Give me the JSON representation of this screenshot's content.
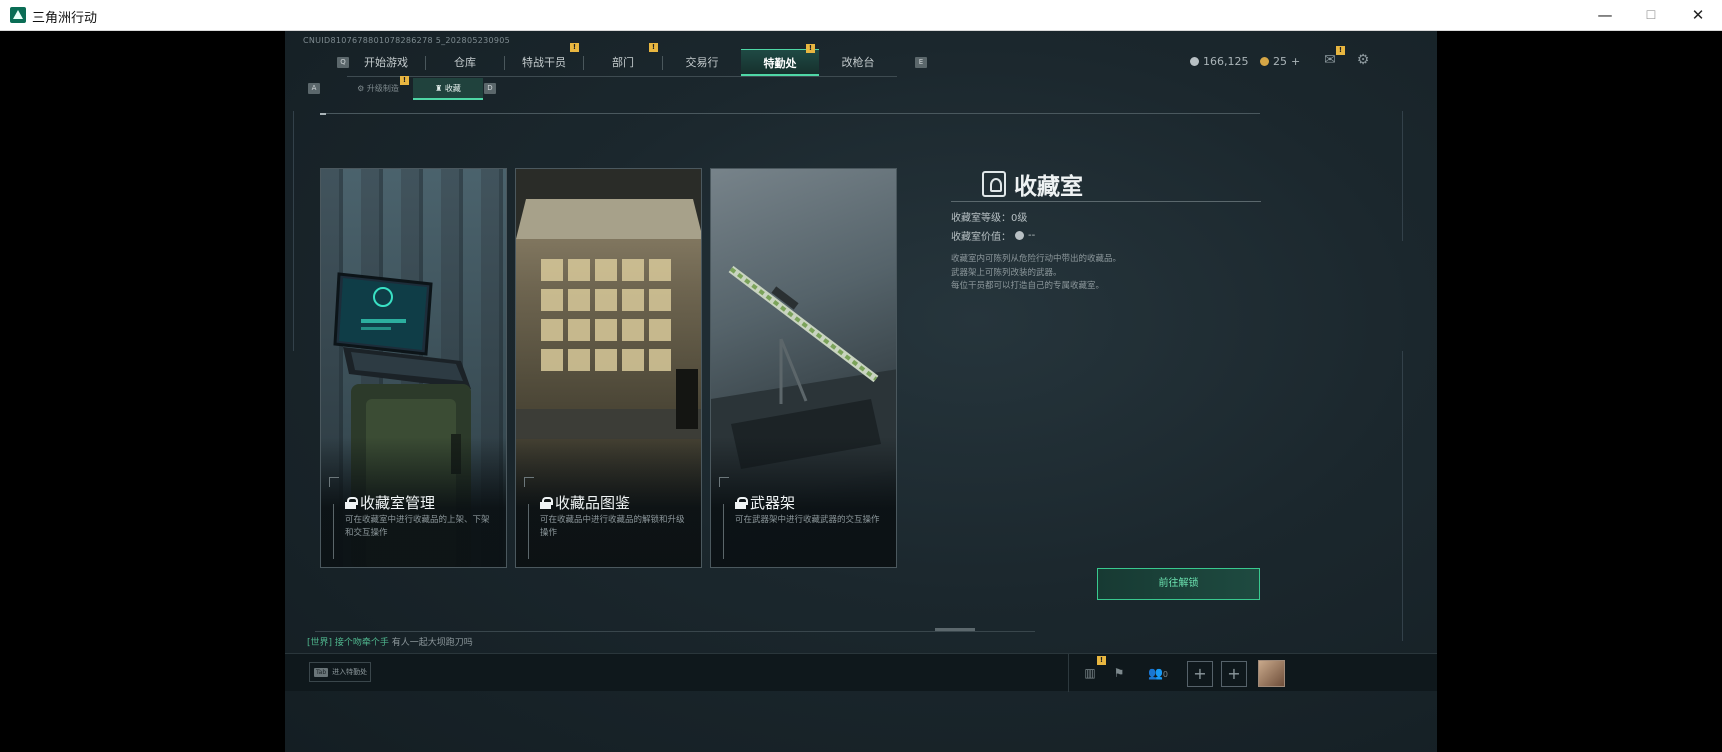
{
  "window": {
    "title": "三角洲行动",
    "minimize": "—",
    "maximize": "☐",
    "close": "✕"
  },
  "uid": "CNUID8107678801078286278 5_202805230905",
  "keyhints": {
    "nav_left": "Q",
    "nav_right": "E",
    "sub_left": "A",
    "sub_right": "D"
  },
  "nav": {
    "items": [
      {
        "label": "开始游戏",
        "badge": ""
      },
      {
        "label": "仓库",
        "badge": ""
      },
      {
        "label": "特战干员",
        "badge": "!"
      },
      {
        "label": "部门",
        "badge": "!"
      },
      {
        "label": "交易行",
        "badge": ""
      },
      {
        "label": "特勤处",
        "badge": "!",
        "active": true
      },
      {
        "label": "改枪台",
        "badge": ""
      }
    ]
  },
  "currency": {
    "silver": "166,125",
    "gold": "25",
    "gold_plus": "+"
  },
  "top_icons": {
    "mail": "mail-icon",
    "settings": "gear-icon",
    "mail_badge": "!"
  },
  "subnav": {
    "items": [
      {
        "label": "升级制造",
        "icon": "wrench-icon",
        "badge": "!"
      },
      {
        "label": "收藏",
        "icon": "trophy-icon",
        "active": true
      }
    ]
  },
  "cards": [
    {
      "title": "收藏室管理",
      "desc": "可在收藏室中进行收藏品的上架、下架和交互操作"
    },
    {
      "title": "收藏品图鉴",
      "desc": "可在收藏品中进行收藏品的解锁和升级操作"
    },
    {
      "title": "武器架",
      "desc": "可在武器架中进行收藏武器的交互操作"
    }
  ],
  "panel": {
    "title": "收藏室",
    "level_label": "收藏室等级：",
    "level_value": "0级",
    "value_label": "收藏室价值：",
    "value_value": "--",
    "desc_lines": [
      "收藏室内可陈列从危险行动中带出的收藏品。",
      "武器架上可陈列改装的武器。",
      "每位干员都可以打造自己的专属收藏室。"
    ],
    "unlock_button": "前往解锁"
  },
  "chat": {
    "channel": "[世界]",
    "user": "接个吻牵个手",
    "message": "有人一起大坝跑刀吗"
  },
  "bottom": {
    "tab_key": "Tab",
    "tab_label": "进入特勤处",
    "friends_count": "0",
    "stats_badge": "!"
  },
  "colors": {
    "accent": "#4fd7a6",
    "badge": "#e8b640",
    "bg": "#1b272d"
  }
}
